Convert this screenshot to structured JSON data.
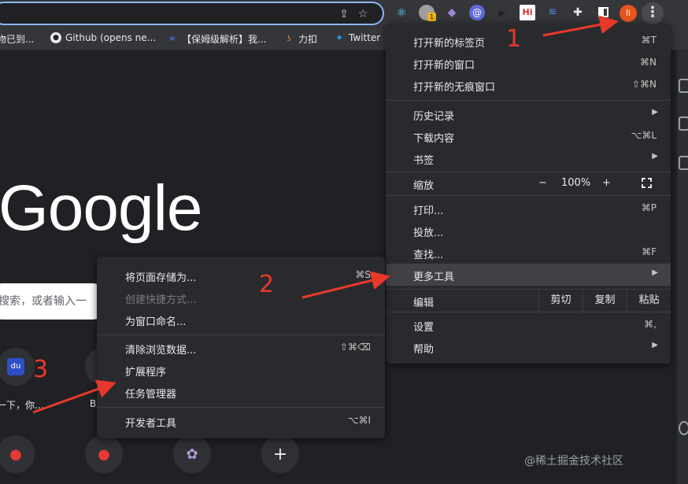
{
  "toolbar": {
    "avatar_letter": "li",
    "extensions": [
      "react-devtools",
      "extension-badge",
      "fox-extension",
      "at-extension",
      "play-extension",
      "hi-extension",
      "layers-extension",
      "puzzle-icon",
      "sidepanel-icon"
    ],
    "ext_badge": "1",
    "ext_hi_label": "Hi"
  },
  "bookmarks": [
    {
      "label": "物已到...",
      "icon": "bookmark-icon"
    },
    {
      "label": "Github (opens ne...",
      "icon": "github-icon"
    },
    {
      "label": "【保姆级解析】我...",
      "icon": "layers-icon"
    },
    {
      "label": "力扣",
      "icon": "leetcode-icon"
    },
    {
      "label": "Twitter",
      "icon": "twitter-icon"
    }
  ],
  "page": {
    "logo": "Google",
    "search_placeholder": "搜索，或者输入一",
    "shortcut_label_1": "一下，你...",
    "shortcut_label_2": "B",
    "add_shortcut": "+",
    "baidu_label": "du"
  },
  "menu": {
    "new_tab": "打开新的标签页",
    "new_tab_sc": "⌘T",
    "new_window": "打开新的窗口",
    "new_window_sc": "⌘N",
    "incognito": "打开新的无痕窗口",
    "incognito_sc": "⇧⌘N",
    "history": "历史记录",
    "downloads": "下载内容",
    "downloads_sc": "⌥⌘L",
    "bookmarks": "书签",
    "zoom": "缩放",
    "zoom_minus": "−",
    "zoom_value": "100%",
    "zoom_plus": "+",
    "print": "打印...",
    "print_sc": "⌘P",
    "cast": "投放...",
    "find": "查找...",
    "find_sc": "⌘F",
    "more_tools": "更多工具",
    "edit": "编辑",
    "cut": "剪切",
    "copy": "复制",
    "paste": "粘贴",
    "settings": "设置",
    "settings_sc": "⌘,",
    "help": "帮助"
  },
  "submenu": {
    "save_page": "将页面存储为...",
    "save_page_sc": "⌘S",
    "create_shortcut": "创建快捷方式...",
    "name_window": "为窗口命名...",
    "clear_data": "清除浏览数据...",
    "clear_data_sc": "⇧⌘⌫",
    "extensions": "扩展程序",
    "task_manager": "任务管理器",
    "dev_tools": "开发者工具",
    "dev_tools_sc": "⌥⌘I"
  },
  "annotations": {
    "n1": "1",
    "n2": "2",
    "n3": "3"
  },
  "watermark": "@稀土掘金技术社区",
  "colors": {
    "accent": "#8ab4f8",
    "annotation": "#e8382a",
    "menu_bg": "#292a2d",
    "page_bg": "#202124"
  }
}
